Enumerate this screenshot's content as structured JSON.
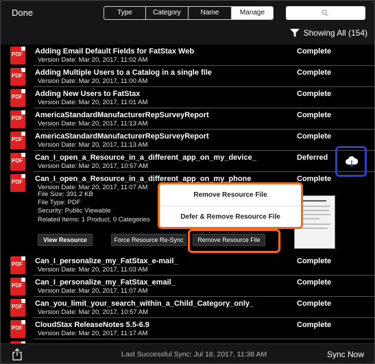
{
  "topbar": {
    "done_label": "Done",
    "segments": [
      "Type",
      "Category",
      "Name",
      "Manage"
    ],
    "active_segment": "Manage",
    "showing_label": "Showing All (154)"
  },
  "rows_top": [
    {
      "title": "Adding Email Default Fields for FatStax Web",
      "date": "Version Date: Mar 20, 2017, 11:02 AM",
      "status": "Complete"
    },
    {
      "title": "Adding Multiple Users to a Catalog in a single file",
      "date": "Version Date: Mar 20, 2017, 11:00 AM",
      "status": "Complete"
    },
    {
      "title": "Adding New Users to FatStax",
      "date": "Version Date: Mar 20, 2017, 11:01 AM",
      "status": "Complete"
    },
    {
      "title": "AmericaStandardManufacturerRepSurveyReport",
      "date": "Version Date: Mar 20, 2017, 11:13 AM",
      "status": "Complete"
    },
    {
      "title": "AmericaStandardManufacturerRepSurveyReport",
      "date": "Version Date: Mar 20, 2017, 11:13 AM",
      "status": "Complete"
    },
    {
      "title": "Can_I_open_a_Resource_in_a_different_app_on_my_device_",
      "date": "Version Date: Mar 20, 2017, 10:57 AM",
      "status": "Deferred"
    }
  ],
  "expanded": {
    "title": "Can_I_open_a_Resource_in_a_different_app_on_my_phone",
    "date": "Version Date: Mar 20, 2017, 11:07 AM",
    "status": "Complete",
    "file_size": "File Size: 391.2 KB",
    "file_type": "File Type: PDF",
    "security": "Security: Public Viewable",
    "related": "Related Items: 1 Product, 0 Categories",
    "view_label": "View Resource",
    "force_label": "Force Resource Re-Sync",
    "remove_label": "Remove Resource File"
  },
  "popup": {
    "item1": "Remove Resource File",
    "item2": "Defer & Remove Resource File"
  },
  "rows_bottom": [
    {
      "title": "Can_I_personalize_my_FatStax_e-mail_",
      "date": "Version Date: Mar 20, 2017, 11:03 AM",
      "status": "Complete"
    },
    {
      "title": "Can_I_personalize_my_FatStax_email_",
      "date": "Version Date: Mar 20, 2017, 11:07 AM",
      "status": "Complete"
    },
    {
      "title": "Can_you_limit_your_search_within_a_Child_Category_only_",
      "date": "Version Date: Mar 20, 2017, 10:57 AM",
      "status": "Complete"
    },
    {
      "title": "CloudStax ReleaseNotes 5.5-6.9",
      "date": "Version Date: Mar 20, 2017, 11:17 AM",
      "status": "Complete"
    }
  ],
  "pdf_label": "PDF",
  "bottombar": {
    "sync_text": "Last Successful Sync: Jul 18, 2017, 11:38 AM",
    "sync_now_label": "Sync Now"
  },
  "colors": {
    "highlight_orange": "#f26b1d",
    "highlight_blue": "#2d3ec7",
    "pdf_red": "#e02020"
  }
}
